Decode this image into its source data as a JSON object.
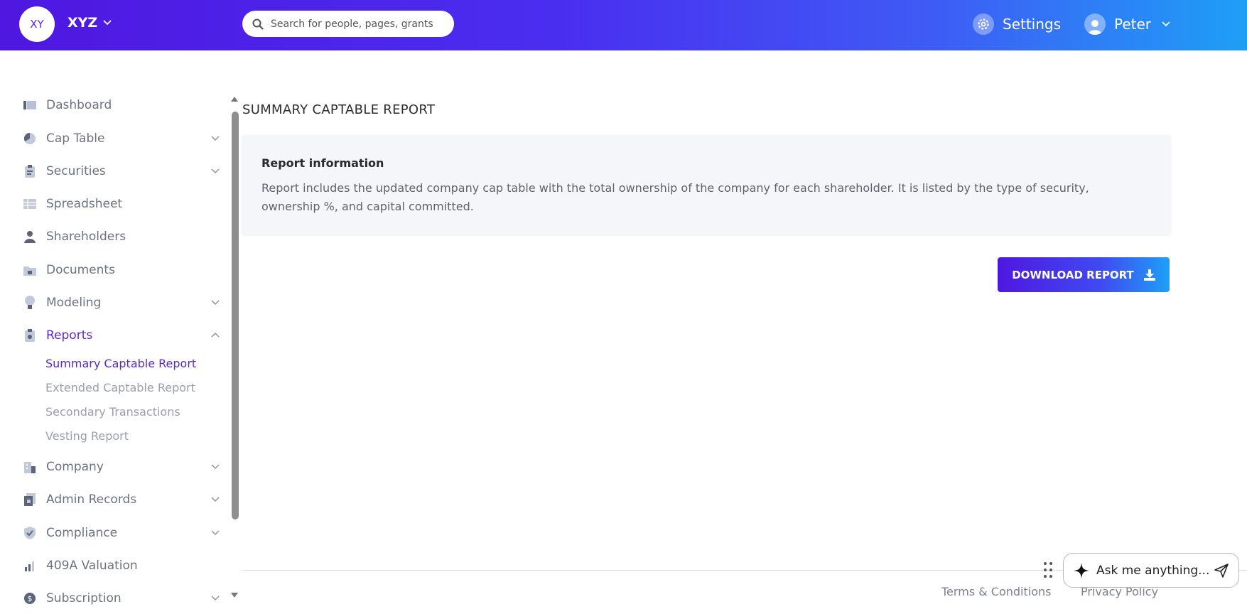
{
  "header": {
    "org_initials": "XY",
    "org_name": "XYZ",
    "search_placeholder": "Search for people, pages, grants",
    "settings_label": "Settings",
    "user_name": "Peter",
    "gradient_start": "#4f17e0",
    "gradient_end": "#1e9ff6"
  },
  "sidebar": {
    "items": [
      {
        "label": "Dashboard",
        "icon": "dashboard-icon"
      },
      {
        "label": "Cap Table",
        "icon": "pie-chart-icon"
      },
      {
        "label": "Securities",
        "icon": "clipboard-icon"
      },
      {
        "label": "Spreadsheet",
        "icon": "spreadsheet-icon"
      },
      {
        "label": "Shareholders",
        "icon": "person-icon"
      },
      {
        "label": "Documents",
        "icon": "folder-lock-icon"
      },
      {
        "label": "Modeling",
        "icon": "lightbulb-icon"
      },
      {
        "label": "Reports",
        "icon": "report-icon"
      },
      {
        "label": "Company",
        "icon": "building-icon"
      },
      {
        "label": "Admin Records",
        "icon": "records-icon"
      },
      {
        "label": "Compliance",
        "icon": "shield-check-icon"
      },
      {
        "label": "409A Valuation",
        "icon": "bar-chart-icon"
      },
      {
        "label": "Subscription",
        "icon": "dollar-icon"
      }
    ],
    "report_subitems": [
      "Summary Captable Report",
      "Extended Captable Report",
      "Secondary Transactions",
      "Vesting Report"
    ],
    "active_color": "#5a27d6"
  },
  "main": {
    "page_title": "SUMMARY CAPTABLE REPORT",
    "card_title": "Report information",
    "card_text": "Report includes the updated company cap table with the total ownership of the company for each shareholder. It is listed by the type of security, ownership %, and capital committed.",
    "download_label": "DOWNLOAD REPORT"
  },
  "footer": {
    "terms": "Terms & Conditions",
    "privacy": "Privacy Policy"
  },
  "assistant": {
    "placeholder": "Ask me anything..."
  }
}
